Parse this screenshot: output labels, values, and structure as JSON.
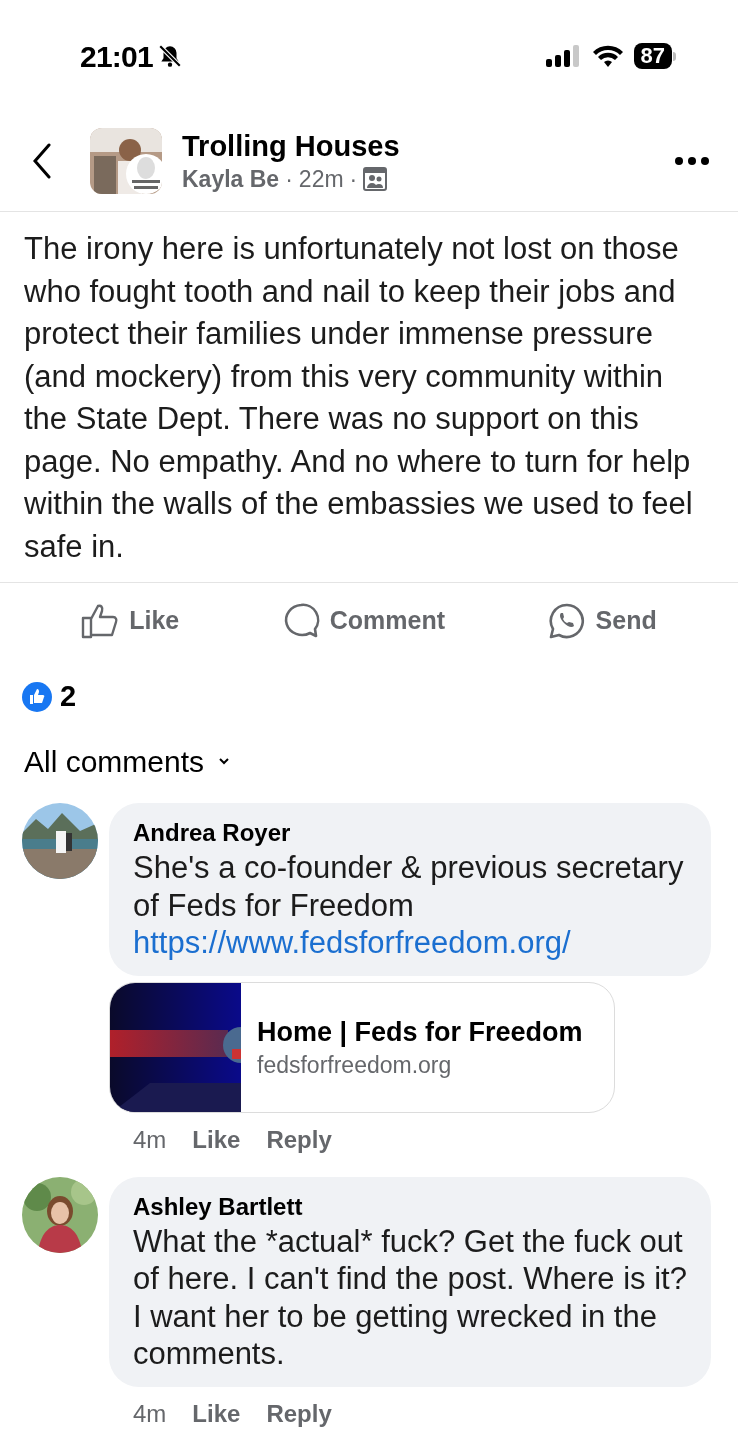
{
  "status_bar": {
    "time": "21:01",
    "battery": "87"
  },
  "header": {
    "title": "Trolling Houses",
    "author": "Kayla Be",
    "separator_1": "·",
    "time": "22m",
    "separator_2": "·"
  },
  "post": {
    "text": "The irony here is unfortunately not lost on those who fought tooth and nail to keep their jobs and protect their families under immense pressure (and mockery) from this very community within the State Dept. There was no support on this page. No empathy. And no where to turn for help within the walls of the embassies we used to feel safe in."
  },
  "actions": [
    {
      "kind": "like",
      "label": "Like"
    },
    {
      "kind": "comment",
      "label": "Comment"
    },
    {
      "kind": "send",
      "label": "Send"
    }
  ],
  "reactions": {
    "count": "2"
  },
  "comments_filter": {
    "label": "All comments"
  },
  "comments": [
    {
      "author": "Andrea Royer",
      "text": "She's a co-founder & previous secretary of Feds for Freedom",
      "link": "https://www.fedsforfreedom.org/",
      "preview": {
        "kind": "picture",
        "title": "Home | Feds for Freedom",
        "domain": "fedsforfreedom.org"
      },
      "time": "4m",
      "like": "Like",
      "reply": "Reply"
    },
    {
      "author": "Ashley Bartlett",
      "text": "What the *actual* fuck? Get the fuck out of here. I can't find the post. Where is it? I want her to be getting wrecked in the comments.",
      "time": "4m",
      "like": "Like",
      "reply": "Reply"
    }
  ]
}
